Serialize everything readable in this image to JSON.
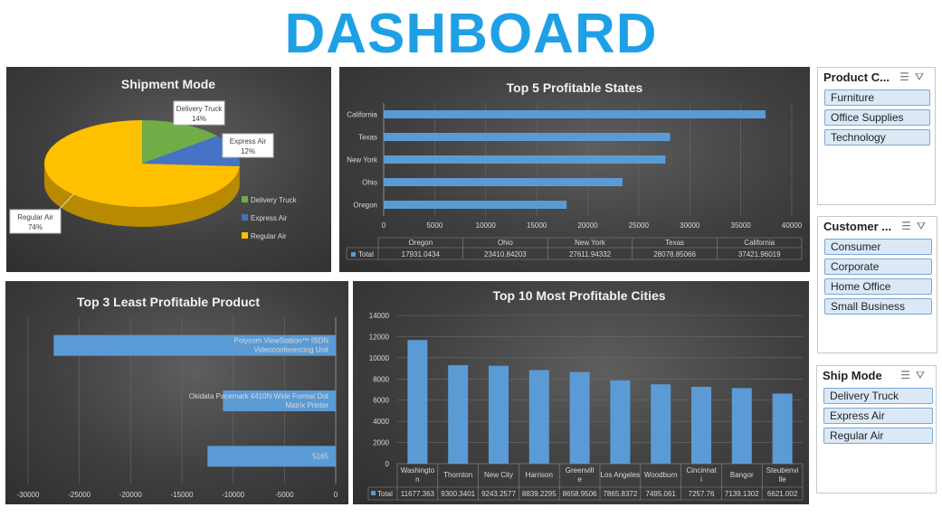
{
  "dashboard_title": "DASHBOARD",
  "chart_data": [
    {
      "type": "pie",
      "title": "Shipment Mode",
      "categories": [
        "Delivery Truck",
        "Express Air",
        "Regular Air"
      ],
      "values": [
        14,
        12,
        74
      ],
      "data_labels": [
        "14%",
        "12%",
        "74%"
      ],
      "colors": [
        "#70ad47",
        "#4472c4",
        "#ffc000"
      ],
      "legend": "right"
    },
    {
      "type": "bar",
      "orientation": "horizontal",
      "title": "Top 5 Profitable States",
      "categories": [
        "Oregon",
        "Ohio",
        "New York",
        "Texas",
        "California"
      ],
      "series": [
        {
          "name": "Total",
          "values": [
            17931.0434,
            23410.84203,
            27611.94332,
            28078.85066,
            37421.96019
          ]
        }
      ],
      "xlim": [
        0,
        40000
      ],
      "xticks": [
        "0",
        "5000",
        "10000",
        "15000",
        "20000",
        "25000",
        "30000",
        "35000",
        "40000"
      ],
      "table": {
        "values": [
          "17931.0434",
          "23410.84203",
          "27611.94332",
          "28078.85066",
          "37421.96019"
        ]
      },
      "grid": true
    },
    {
      "type": "bar",
      "orientation": "horizontal",
      "title": "Top 3 Least Profitable Product",
      "categories": [
        "Polycom ViewStation™ ISDN Videoconferencing Unit",
        "Okidata Pacemark 4410N Wide Format Dot Matrix Printer",
        "5165"
      ],
      "values": [
        -27500,
        -11000,
        -12500
      ],
      "xlim": [
        -30000,
        0
      ],
      "xticks": [
        "-30000",
        "-25000",
        "-20000",
        "-15000",
        "-10000",
        "-5000",
        "0"
      ],
      "grid": true
    },
    {
      "type": "bar",
      "title": "Top 10 Most Profitable Cities",
      "categories": [
        "Washington",
        "Thornton",
        "New City",
        "Harrison",
        "Greenville",
        "Los Angeles",
        "Woodburn",
        "Cincinnati",
        "Bangor",
        "Steubenville"
      ],
      "series": [
        {
          "name": "Total",
          "values": [
            11677.363,
            9300.3401,
            9243.2577,
            8839.2295,
            8658.9506,
            7865.8372,
            7495.061,
            7257.76,
            7139.1302,
            6621.002
          ]
        }
      ],
      "ylim": [
        0,
        14000
      ],
      "yticks": [
        "0",
        "2000",
        "4000",
        "6000",
        "8000",
        "10000",
        "12000",
        "14000"
      ],
      "table": {
        "values": [
          "11677.363",
          "9300.3401",
          "9243.2577",
          "8839.2295",
          "8658.9506",
          "7865.8372",
          "7495.061",
          "7257.76",
          "7139.1302",
          "6621.002"
        ]
      },
      "grid": true
    }
  ],
  "slicers": [
    {
      "title": "Product C...",
      "items": [
        "Furniture",
        "Office Supplies",
        "Technology"
      ]
    },
    {
      "title": "Customer ...",
      "items": [
        "Consumer",
        "Corporate",
        "Home Office",
        "Small Business"
      ]
    },
    {
      "title": "Ship Mode",
      "items": [
        "Delivery Truck",
        "Express Air",
        "Regular Air"
      ]
    }
  ],
  "icons": {
    "multi_select": "multi-select-icon",
    "clear_filter": "clear-filter-icon"
  },
  "colors": {
    "title": "#1ea0e6",
    "bar": "#5b9bd5"
  }
}
